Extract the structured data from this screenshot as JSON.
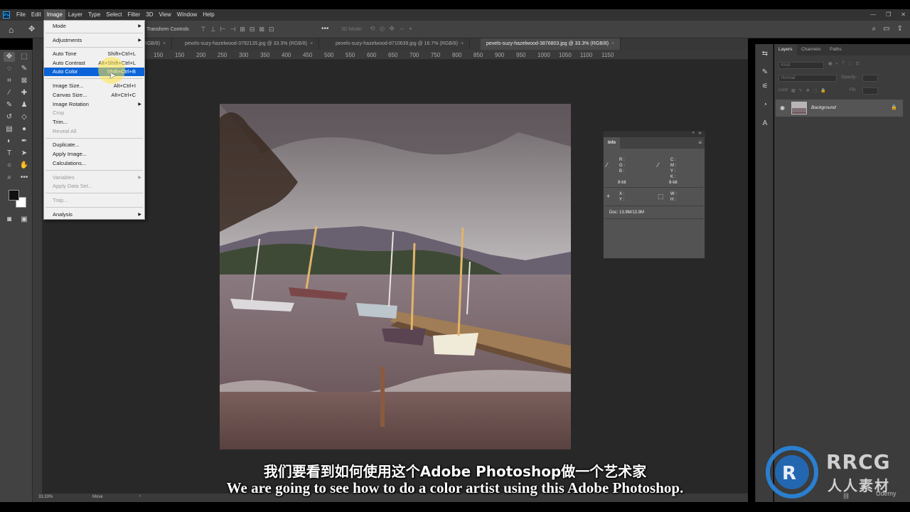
{
  "app": {
    "logo": "Ps",
    "menu": [
      "File",
      "Edit",
      "Image",
      "Layer",
      "Type",
      "Select",
      "Filter",
      "3D",
      "View",
      "Window",
      "Help"
    ],
    "active_menu": "Image",
    "window_controls": [
      "—",
      "❐",
      "✕"
    ]
  },
  "options_bar": {
    "transform_controls": "Transform Controls",
    "three_d_mode": "3D Mode:"
  },
  "tabs": [
    {
      "label": "s (RGB/8)"
    },
    {
      "label": "pexels-suzy-hazelwood-3792135.jpg @ 33.3% (RGB/8)"
    },
    {
      "label": "pexels-suzy-hazelwood-8710639.jpg @ 16.7% (RGB/8)"
    },
    {
      "label": "pexels-suzy-hazelwood-3876803.jpg @ 33.3% (RGB/8)"
    }
  ],
  "tab_close": "×",
  "ruler_h": [
    "150",
    "100",
    "150",
    "200",
    "250",
    "300",
    "350",
    "400",
    "450",
    "500",
    "550",
    "600",
    "650",
    "700",
    "750",
    "800",
    "850",
    "900",
    "950",
    "1000",
    "1050",
    "1100",
    "1150"
  ],
  "image_menu": {
    "mode": "Mode",
    "adjustments": "Adjustments",
    "auto_tone": {
      "label": "Auto Tone",
      "shortcut": "Shift+Ctrl+L"
    },
    "auto_contrast": {
      "label": "Auto Contrast",
      "shortcut": "Alt+Shift+Ctrl+L"
    },
    "auto_color": {
      "label": "Auto Color",
      "shortcut": "Shift+Ctrl+B"
    },
    "image_size": {
      "label": "Image Size...",
      "shortcut": "Alt+Ctrl+I"
    },
    "canvas_size": {
      "label": "Canvas Size...",
      "shortcut": "Alt+Ctrl+C"
    },
    "image_rotation": "Image Rotation",
    "crop": "Crop",
    "trim": "Trim...",
    "reveal_all": "Reveal All",
    "duplicate": "Duplicate...",
    "apply_image": "Apply Image...",
    "calculations": "Calculations...",
    "variables": "Variables",
    "apply_data_set": "Apply Data Set...",
    "trap": "Trap...",
    "analysis": "Analysis",
    "submenu_arrow": "▶"
  },
  "info_panel": {
    "title": "Info",
    "rgb": "R :\nG :\nB :",
    "cmyk": "C :\nM :\nY :\nK :",
    "bit1": "8-bit",
    "bit2": "8-bit",
    "xy": "X :\nY :",
    "wh": "W :\nH :",
    "doc": "Doc: 13.9M/13.9M"
  },
  "layers_panel": {
    "tabs": [
      "Layers",
      "Channels",
      "Paths"
    ],
    "kind": "Kind",
    "blend": "Normal",
    "opacity": "Opacity:",
    "lock": "Lock:",
    "fill": "Fill:",
    "layer_name": "Background"
  },
  "status": {
    "zoom": "33.33%",
    "tool": "Move"
  },
  "subtitles": {
    "cn": "我们要看到如何使用这个Adobe Photoshop做一个艺术家",
    "en": "We are going to see how to do a color artist using this Adobe Photoshop."
  },
  "watermark": {
    "brand": "RRCG",
    "brand_cn": "人人素材",
    "udemy": "Udemy"
  },
  "colors": {
    "menu_highlight": "#0a64d8",
    "canvas_bg": "#282828",
    "panel_bg": "#3c3c3c"
  }
}
